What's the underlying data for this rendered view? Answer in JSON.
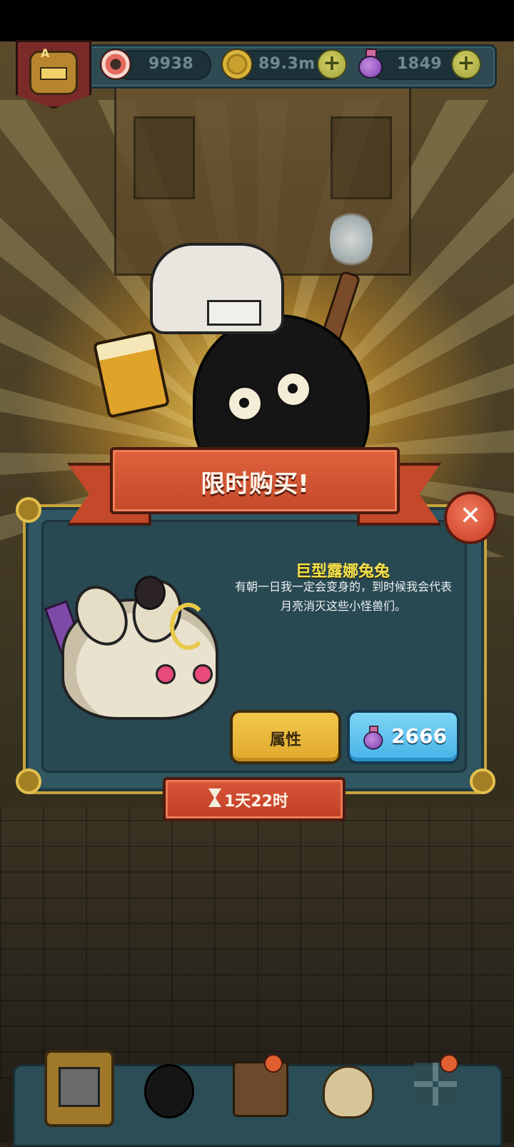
{
  "topbar": {
    "eyes": {
      "value": "9938",
      "icon": "eyeball-icon"
    },
    "coins": {
      "value": "89.3m",
      "icon": "coin-icon"
    },
    "potions": {
      "value": "1849",
      "icon": "potion-icon"
    },
    "rank_badge": {
      "letter": "A"
    }
  },
  "offer": {
    "banner_title": "限时购买!",
    "item_name": "巨型露娜兔兔",
    "item_desc": "有朝一日我一定会变身的，到时候我会代表月亮消灭这些小怪兽们。",
    "attributes_label": "属性",
    "price": "2666",
    "price_currency_icon": "potion-icon",
    "timer": "1天22时"
  },
  "close_label": "✕",
  "colors": {
    "banner": "#c44a2a",
    "panel": "#2f5661",
    "gold_trim": "#c9a23a",
    "item_name": "#f6e24c",
    "buy_button": "#46b2e8",
    "attr_button": "#e1a92e"
  },
  "bottom_nav": [
    "shop-icon",
    "monster-icon",
    "book-icon",
    "bag-icon",
    "grid-icon"
  ]
}
